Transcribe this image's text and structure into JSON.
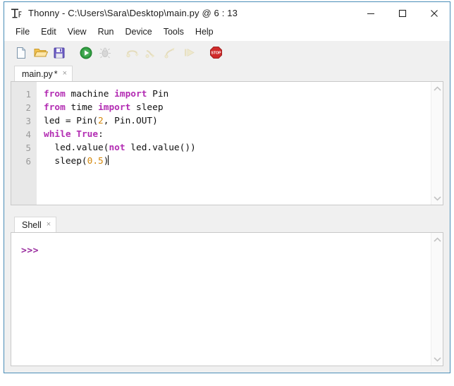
{
  "window": {
    "title": "Thonny  -  C:\\Users\\Sara\\Desktop\\main.py  @  6 : 13",
    "app_icon": "thonny-icon",
    "controls": {
      "minimize": "—",
      "maximize": "☐",
      "close": "✕"
    }
  },
  "menubar": {
    "items": [
      {
        "label": "File"
      },
      {
        "label": "Edit"
      },
      {
        "label": "View"
      },
      {
        "label": "Run"
      },
      {
        "label": "Device"
      },
      {
        "label": "Tools"
      },
      {
        "label": "Help"
      }
    ]
  },
  "toolbar": {
    "buttons": [
      {
        "name": "new-file-button",
        "icon": "new-file-icon",
        "tooltip": "New"
      },
      {
        "name": "open-file-button",
        "icon": "open-folder-icon",
        "tooltip": "Load"
      },
      {
        "name": "save-file-button",
        "icon": "save-disk-icon",
        "tooltip": "Save"
      },
      {
        "name": "run-button",
        "icon": "run-play-icon",
        "tooltip": "Run current script"
      },
      {
        "name": "debug-button",
        "icon": "debug-bug-icon",
        "tooltip": "Debug current script"
      },
      {
        "name": "step-over-button",
        "icon": "step-over-icon",
        "tooltip": "Step over"
      },
      {
        "name": "step-into-button",
        "icon": "step-into-icon",
        "tooltip": "Step into"
      },
      {
        "name": "step-out-button",
        "icon": "step-out-icon",
        "tooltip": "Step out"
      },
      {
        "name": "resume-button",
        "icon": "resume-icon",
        "tooltip": "Resume"
      },
      {
        "name": "stop-button",
        "icon": "stop-sign-icon",
        "tooltip": "Stop/Restart backend"
      }
    ]
  },
  "editor": {
    "tab": {
      "label": "main.py",
      "dirty_marker": "*",
      "close_glyph": "×"
    },
    "line_numbers": [
      "1",
      "2",
      "3",
      "4",
      "5",
      "6"
    ],
    "code_lines": [
      [
        {
          "t": "from",
          "c": "kw"
        },
        {
          "t": " machine ",
          "c": "plain"
        },
        {
          "t": "import",
          "c": "kw"
        },
        {
          "t": " Pin",
          "c": "plain"
        }
      ],
      [
        {
          "t": "from",
          "c": "kw"
        },
        {
          "t": " time ",
          "c": "plain"
        },
        {
          "t": "import",
          "c": "kw"
        },
        {
          "t": " sleep",
          "c": "plain"
        }
      ],
      [
        {
          "t": "led = Pin(",
          "c": "plain"
        },
        {
          "t": "2",
          "c": "num"
        },
        {
          "t": ", Pin.OUT)",
          "c": "plain"
        }
      ],
      [
        {
          "t": "while",
          "c": "kw"
        },
        {
          "t": " ",
          "c": "plain"
        },
        {
          "t": "True",
          "c": "kw"
        },
        {
          "t": ":",
          "c": "plain"
        }
      ],
      [
        {
          "t": "  led.value(",
          "c": "plain"
        },
        {
          "t": "not",
          "c": "kw"
        },
        {
          "t": " led.value())",
          "c": "plain"
        }
      ],
      [
        {
          "t": "  sleep(",
          "c": "plain"
        },
        {
          "t": "0.5",
          "c": "num"
        },
        {
          "t": ")",
          "c": "plain"
        }
      ]
    ],
    "cursor_position": "6 : 13",
    "scrollbar": {
      "up_glyph": "⌃",
      "down_glyph": "⌄"
    }
  },
  "shell": {
    "tab": {
      "label": "Shell",
      "close_glyph": "×"
    },
    "prompt": ">>>",
    "output": "",
    "scrollbar": {
      "up_glyph": "⌃",
      "down_glyph": "⌄"
    }
  },
  "watermark": {
    "line1": "",
    "line2": ""
  },
  "colors": {
    "keyword": "#b32db3",
    "number": "#d4870a",
    "prompt": "#9b30a0",
    "window_border": "#4a8db7",
    "gutter_bg": "#e8e8e8",
    "toolbar_bg": "#f0f0f0"
  }
}
